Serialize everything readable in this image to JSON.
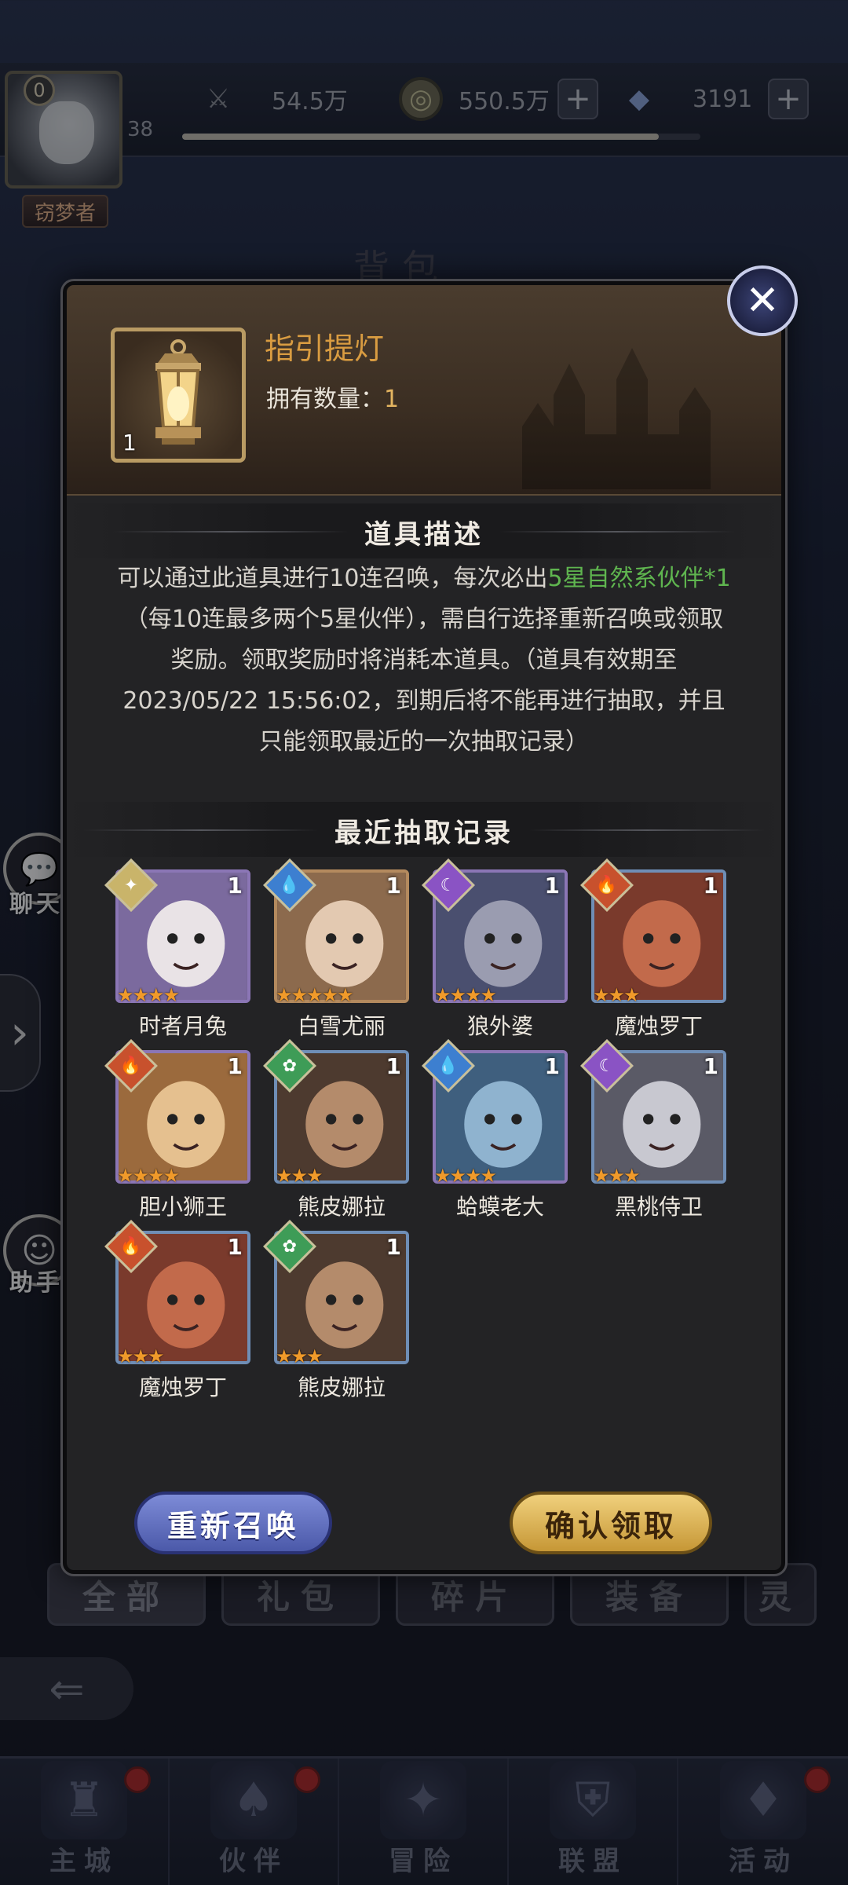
{
  "topbar": {
    "level": "0",
    "lv_number": "38",
    "title_tag": "窃梦者",
    "power": "54.5万",
    "gold": "550.5万",
    "diamonds": "3191",
    "plus": "+",
    "xp_fraction": 0.92
  },
  "background_title": "背包",
  "side": {
    "chat_label": "聊天",
    "assistant_label": "助手",
    "expand_arrow": "›"
  },
  "modal": {
    "item_name": "指引提灯",
    "item_count": "1",
    "own_label": "拥有数量：",
    "own_value": "1",
    "desc_title": "道具描述",
    "desc_part1": "可以通过此道具进行10连召唤，每次必出",
    "desc_green": "5星自然系伙伴*1",
    "desc_part2": "（每10连最多两个5星伙伴），需自行选择重新召唤或领取奖励。领取奖励时将消耗本道具。（道具有效期至2023/05/22 15:56:02，到期后将不能再进行抽取，并且只能领取最近的一次抽取记录）",
    "records_title": "最近抽取记录",
    "records": [
      {
        "name": "时者月兔",
        "count": "1",
        "stars": "★★★★",
        "element": "light-icon",
        "frame": "purple"
      },
      {
        "name": "白雪尤丽",
        "count": "1",
        "stars": "★★★★★",
        "element": "water-icon",
        "frame": "orange"
      },
      {
        "name": "狼外婆",
        "count": "1",
        "stars": "★★★★",
        "element": "dark-icon",
        "frame": "purple"
      },
      {
        "name": "魔烛罗丁",
        "count": "1",
        "stars": "★★★",
        "element": "fire-icon",
        "frame": "blue"
      },
      {
        "name": "胆小狮王",
        "count": "1",
        "stars": "★★★★",
        "element": "fire-icon",
        "frame": "purple"
      },
      {
        "name": "熊皮娜拉",
        "count": "1",
        "stars": "★★★",
        "element": "nature-icon",
        "frame": "blue"
      },
      {
        "name": "蛤蟆老大",
        "count": "1",
        "stars": "★★★★",
        "element": "water-icon",
        "frame": "purple"
      },
      {
        "name": "黑桃侍卫",
        "count": "1",
        "stars": "★★★",
        "element": "dark-icon",
        "frame": "blue"
      },
      {
        "name": "魔烛罗丁",
        "count": "1",
        "stars": "★★★",
        "element": "fire-icon",
        "frame": "blue"
      },
      {
        "name": "熊皮娜拉",
        "count": "1",
        "stars": "★★★",
        "element": "nature-icon",
        "frame": "blue"
      }
    ],
    "btn_resummon": "重新召唤",
    "btn_confirm": "确认领取",
    "close": "✕"
  },
  "category_tabs": [
    "全部",
    "礼包",
    "碎片",
    "装备",
    "灵"
  ],
  "nav": [
    "主城",
    "伙伴",
    "冒险",
    "联盟",
    "活动"
  ],
  "colors": {
    "green_text": "#5fb54f",
    "item_name": "#d99c41",
    "star": "#f09a2a"
  }
}
